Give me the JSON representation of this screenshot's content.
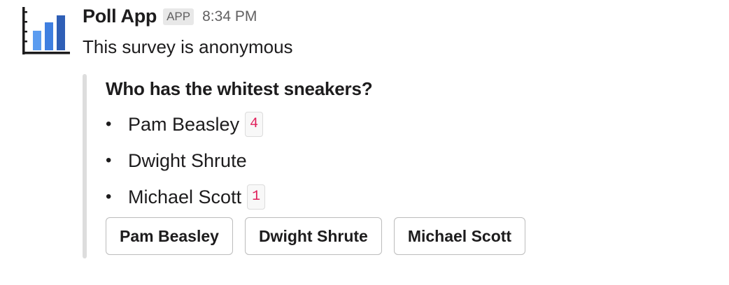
{
  "message": {
    "sender": "Poll App",
    "badge": "APP",
    "time": "8:34 PM",
    "text": "This survey is anonymous",
    "avatar_icon": "bar-chart-icon"
  },
  "poll": {
    "question": "Who has the whitest sneakers?",
    "bullet": "•",
    "options": [
      {
        "label": "Pam Beasley",
        "count": "4"
      },
      {
        "label": "Dwight Shrute",
        "count": ""
      },
      {
        "label": "Michael Scott",
        "count": "1"
      }
    ],
    "buttons": [
      "Pam Beasley",
      "Dwight Shrute",
      "Michael Scott"
    ],
    "count_color": "#e01e5a"
  },
  "colors": {
    "bar_light": "#5b9cf0",
    "bar_mid": "#3f7fe0",
    "bar_dark": "#2f5fb6",
    "axis": "#1d1c1d"
  }
}
